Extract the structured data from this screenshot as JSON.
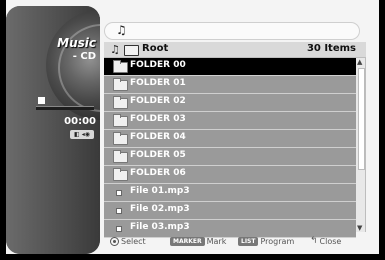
{
  "player": {
    "title": "Music",
    "media": "- CD",
    "time": "00:00",
    "audio_badge": "◧ ◂◉"
  },
  "path": {
    "icon_glyph": "♫"
  },
  "list": {
    "header_icon_glyph": "♫",
    "header_label": "Root",
    "item_count": "30 Items",
    "items": [
      {
        "label": "FOLDER 00",
        "type": "folder",
        "selected": true
      },
      {
        "label": "FOLDER 01",
        "type": "folder"
      },
      {
        "label": "FOLDER 02",
        "type": "folder"
      },
      {
        "label": "FOLDER 03",
        "type": "folder"
      },
      {
        "label": "FOLDER 04",
        "type": "folder"
      },
      {
        "label": "FOLDER 05",
        "type": "folder"
      },
      {
        "label": "FOLDER 06",
        "type": "folder"
      },
      {
        "label": "File 01.mp3",
        "type": "file"
      },
      {
        "label": "File 02.mp3",
        "type": "file"
      },
      {
        "label": "File 03.mp3",
        "type": "file"
      }
    ],
    "scroll_up_glyph": "▲",
    "scroll_down_glyph": "▼"
  },
  "footer": {
    "select_label": "Select",
    "marker_key": "MARKER",
    "mark_label": "Mark",
    "list_key": "LIST",
    "program_label": "Program",
    "return_glyph": "↰",
    "close_label": "Close"
  }
}
